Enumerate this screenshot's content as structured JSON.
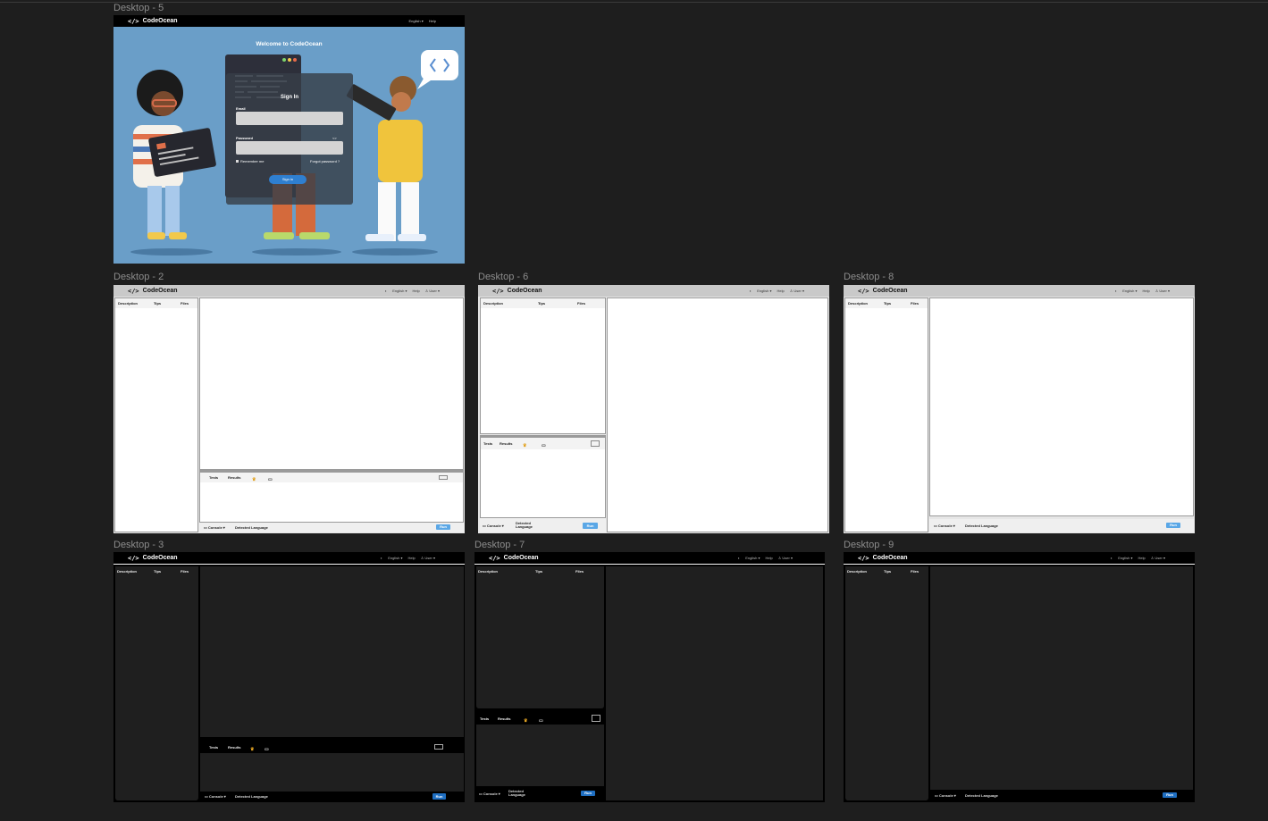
{
  "brand": {
    "icon": "</>",
    "name": "CodeOcean"
  },
  "frames": {
    "d5": {
      "label": "Desktop - 5"
    },
    "d2": {
      "label": "Desktop - 2"
    },
    "d6": {
      "label": "Desktop - 6"
    },
    "d8": {
      "label": "Desktop - 8"
    },
    "d3": {
      "label": "Desktop - 3"
    },
    "d7": {
      "label": "Desktop - 7"
    },
    "d9": {
      "label": "Desktop - 9"
    }
  },
  "nav": {
    "language": "English",
    "help": "Help",
    "user": "User",
    "chevron": "▾"
  },
  "signin": {
    "welcome": "Welcome to CodeOcean",
    "title": "Sign In",
    "email_label": "Email",
    "password_label": "Password",
    "remember": "Remember me",
    "forgot": "Forgot password ?",
    "button": "Sign in"
  },
  "sidebar_tabs": {
    "description": "Description",
    "tips": "Tips",
    "files": "Files"
  },
  "bottom_tabs": {
    "tests": "Tests",
    "results": "Results"
  },
  "footer": {
    "console": "Console",
    "detected": "Detected Language",
    "detected_line1": "Detected",
    "detected_line2": "Language",
    "run": "Run"
  },
  "colors": {
    "signin_bg": "#6a9ec8",
    "run_light": "#5aa7e6",
    "run_dark": "#1f6fc2",
    "canvas": "#1e1e1e"
  }
}
